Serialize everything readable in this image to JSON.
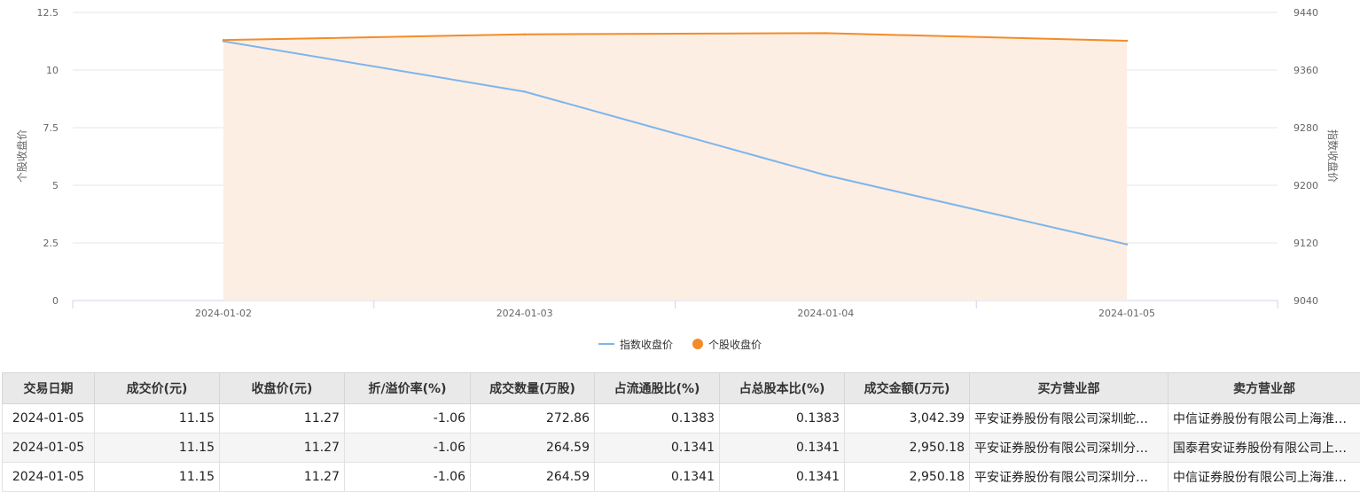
{
  "chart_data": {
    "type": "line",
    "x": [
      "2024-01-02",
      "2024-01-03",
      "2024-01-04",
      "2024-01-05"
    ],
    "y_left": {
      "label": "个股收盘价",
      "ticks": [
        "0",
        "2.5",
        "5",
        "7.5",
        "10",
        "12.5"
      ],
      "range": [
        0,
        12.5
      ]
    },
    "y_right": {
      "label": "指数收盘价",
      "ticks": [
        "9040",
        "9120",
        "9200",
        "9280",
        "9360",
        "9440"
      ],
      "range": [
        9040,
        9440
      ]
    },
    "series": [
      {
        "name": "指数收盘价",
        "axis": "right",
        "color": "#7cb5ec",
        "values": [
          9400,
          9330,
          9214,
          9118
        ]
      },
      {
        "name": "个股收盘价",
        "axis": "left",
        "color": "#f28c28",
        "fill": "#fdeee3",
        "values": [
          11.3,
          11.55,
          11.6,
          11.27
        ]
      }
    ],
    "grid": true,
    "legend": "bottom-center"
  },
  "table": {
    "columns": [
      "交易日期",
      "成交价(元)",
      "收盘价(元)",
      "折/溢价率(%)",
      "成交数量(万股)",
      "占流通股比(%)",
      "占总股本比(%)",
      "成交金额(万元)",
      "买方营业部",
      "卖方营业部"
    ],
    "rows": [
      [
        "2024-01-05",
        "11.15",
        "11.27",
        "-1.06",
        "272.86",
        "0.1383",
        "0.1383",
        "3,042.39",
        "平安证券股份有限公司深圳蛇…",
        "中信证券股份有限公司上海淮…"
      ],
      [
        "2024-01-05",
        "11.15",
        "11.27",
        "-1.06",
        "264.59",
        "0.1341",
        "0.1341",
        "2,950.18",
        "平安证券股份有限公司深圳分…",
        "国泰君安证券股份有限公司上…"
      ],
      [
        "2024-01-05",
        "11.15",
        "11.27",
        "-1.06",
        "264.59",
        "0.1341",
        "0.1341",
        "2,950.18",
        "平安证券股份有限公司深圳分…",
        "中信证券股份有限公司上海淮…"
      ]
    ]
  }
}
